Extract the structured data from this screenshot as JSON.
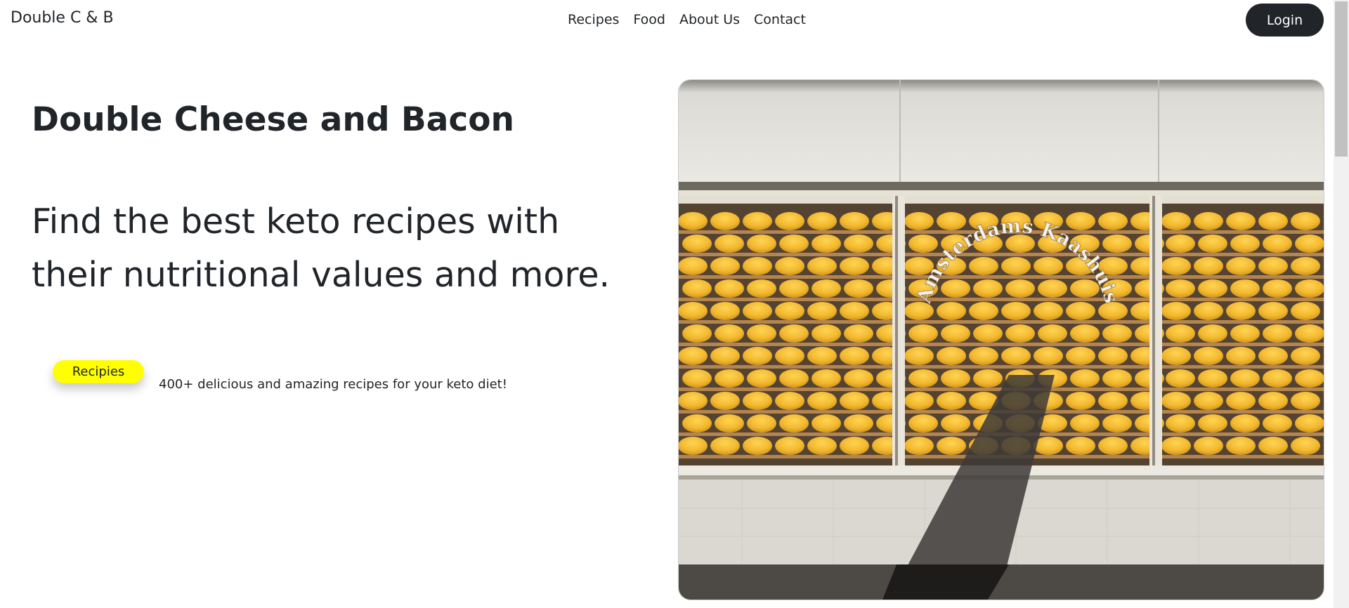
{
  "navbar": {
    "brand": "Double C & B",
    "links": [
      "Recipes",
      "Food",
      "About Us",
      "Contact"
    ],
    "login_label": "Login"
  },
  "hero": {
    "title": "Double Cheese and Bacon",
    "lead": "Find the best keto recipes with their nutritional values and more.",
    "badge_label": "Recipies",
    "subtitle": "400+ delicious and amazing recipes for your keto diet!",
    "image": {
      "sign_text": "Amsterdams Kaashuis"
    }
  },
  "colors": {
    "text": "#212529",
    "login_bg": "#212529",
    "badge_bg": "#ffff00",
    "cheese": "#f2b422"
  }
}
